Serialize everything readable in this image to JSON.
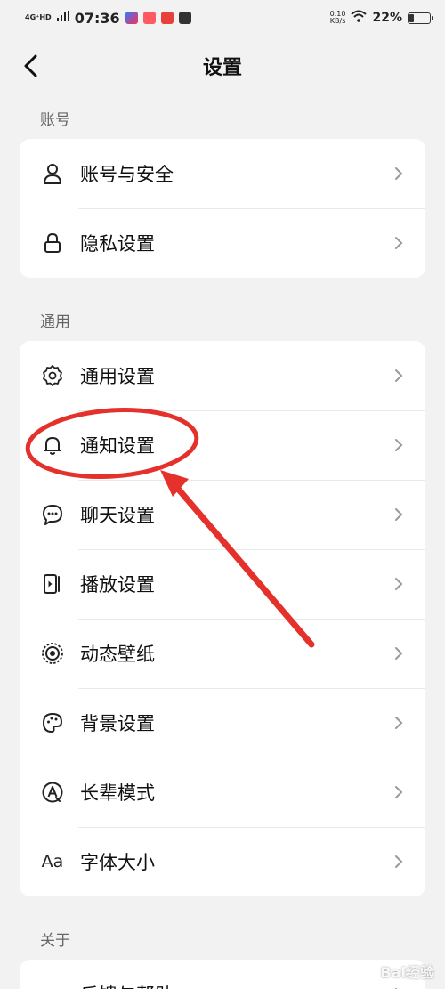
{
  "status_bar": {
    "network": "4G⁺HD",
    "time": "07:36",
    "net_speed_value": "0.10",
    "net_speed_unit": "KB/s",
    "battery_pct": "22%",
    "battery_level": 0.22
  },
  "header": {
    "title": "设置"
  },
  "sections": [
    {
      "label": "账号",
      "items": [
        {
          "label": "账号与安全",
          "icon": "user-icon"
        },
        {
          "label": "隐私设置",
          "icon": "lock-icon"
        }
      ]
    },
    {
      "label": "通用",
      "items": [
        {
          "label": "通用设置",
          "icon": "gear-icon"
        },
        {
          "label": "通知设置",
          "icon": "bell-icon"
        },
        {
          "label": "聊天设置",
          "icon": "chat-bubble-icon"
        },
        {
          "label": "播放设置",
          "icon": "play-settings-icon"
        },
        {
          "label": "动态壁纸",
          "icon": "live-wallpaper-icon"
        },
        {
          "label": "背景设置",
          "icon": "palette-icon"
        },
        {
          "label": "长辈模式",
          "icon": "elder-mode-icon"
        },
        {
          "label": "字体大小",
          "icon": "font-size-icon",
          "icon_text": "Aa"
        }
      ]
    },
    {
      "label": "关于",
      "items": [
        {
          "label": "反馈与帮助",
          "icon": "help-icon"
        }
      ]
    }
  ],
  "watermark": "Bai经验",
  "colors": {
    "annotation_red": "#e5312b",
    "background": "#f2f2f2",
    "card": "#ffffff"
  }
}
